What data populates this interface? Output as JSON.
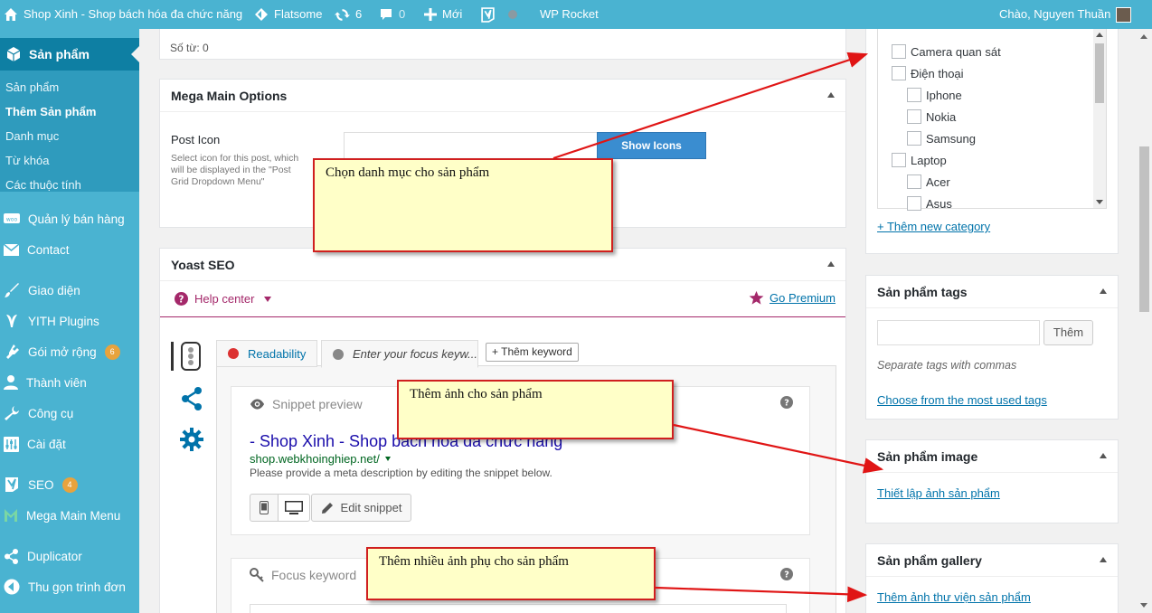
{
  "adminbar": {
    "site_name": "Shop Xinh - Shop bách hóa đa chức năng",
    "theme": "Flatsome",
    "updates": "6",
    "comments": "0",
    "new_label": "Mới",
    "rocket": "WP Rocket",
    "greeting": "Chào, Nguyen Thuần"
  },
  "sidebar": {
    "current": "Sản phẩm",
    "sub": [
      "Sản phẩm",
      "Thêm Sản phẩm",
      "Danh mục",
      "Từ khóa",
      "Các thuộc tính"
    ],
    "items": [
      {
        "label": "Quản lý bán hàng",
        "icon": "woo-icon"
      },
      {
        "label": "Contact",
        "icon": "mail-icon"
      },
      {
        "label": "Giao diện",
        "icon": "brush-icon"
      },
      {
        "label": "YITH Plugins",
        "icon": "yith-icon"
      },
      {
        "label": "Gói mở rộng",
        "icon": "plugin-icon",
        "badge": "6"
      },
      {
        "label": "Thành viên",
        "icon": "users-icon"
      },
      {
        "label": "Công cụ",
        "icon": "wrench-icon"
      },
      {
        "label": "Cài đặt",
        "icon": "settings-icon"
      },
      {
        "label": "SEO",
        "icon": "yoast-icon",
        "badge": "4"
      },
      {
        "label": "Mega Main Menu",
        "icon": "mega-icon"
      },
      {
        "label": "Duplicator",
        "icon": "share-icon"
      },
      {
        "label": "Thu gọn trình đơn",
        "icon": "collapse-icon"
      }
    ]
  },
  "word_count": "Số từ: 0",
  "mega": {
    "title": "Mega Main Options",
    "post_icon_label": "Post Icon",
    "post_icon_desc": "Select icon for this post, which will be displayed in the \"Post Grid Dropdown Menu\"",
    "show_icons": "Show Icons"
  },
  "yoast": {
    "title": "Yoast SEO",
    "help": "Help center",
    "premium": "Go Premium",
    "tab_readability": "Readability",
    "tab_focus": "Enter your focus keyw...",
    "add_keyword": "+ Thêm keyword",
    "snippet_title": "Snippet preview",
    "snippet_link": "- Shop Xinh - Shop bách hóa đa chức năng",
    "snippet_url": "shop.webkhoinghiep.net/",
    "snippet_desc": "Please provide a meta description by editing the snippet below.",
    "edit_snippet": "Edit snippet",
    "focus_title": "Focus keyword"
  },
  "categories": {
    "items": [
      {
        "label": "Camera quan sát",
        "level": 0
      },
      {
        "label": "Điện thoại",
        "level": 0
      },
      {
        "label": "Iphone",
        "level": 1
      },
      {
        "label": "Nokia",
        "level": 1
      },
      {
        "label": "Samsung",
        "level": 1
      },
      {
        "label": "Laptop",
        "level": 0
      },
      {
        "label": "Acer",
        "level": 1
      },
      {
        "label": "Asus",
        "level": 1
      }
    ],
    "add_link": "+ Thêm new category"
  },
  "tags": {
    "title": "Sản phẩm tags",
    "add_button": "Thêm",
    "hint": "Separate tags with commas",
    "choose": "Choose from the most used tags"
  },
  "image": {
    "title": "Sản phẩm image",
    "set_link": "Thiết lập ảnh sản phẩm"
  },
  "gallery": {
    "title": "Sản phẩm gallery",
    "add_link": "Thêm ảnh thư viện sản phẩm"
  },
  "notes": {
    "category": "Chọn danh mục cho sản phẩm",
    "image": "Thêm ảnh cho sản phẩm",
    "gallery": "Thêm nhiều ảnh phụ cho sản phẩm"
  },
  "colors": {
    "adminbar": "#4ab3d1",
    "sidebar_active": "#0e7fa3",
    "button_blue": "#3a8dd0",
    "arrow_red": "#e01515"
  }
}
